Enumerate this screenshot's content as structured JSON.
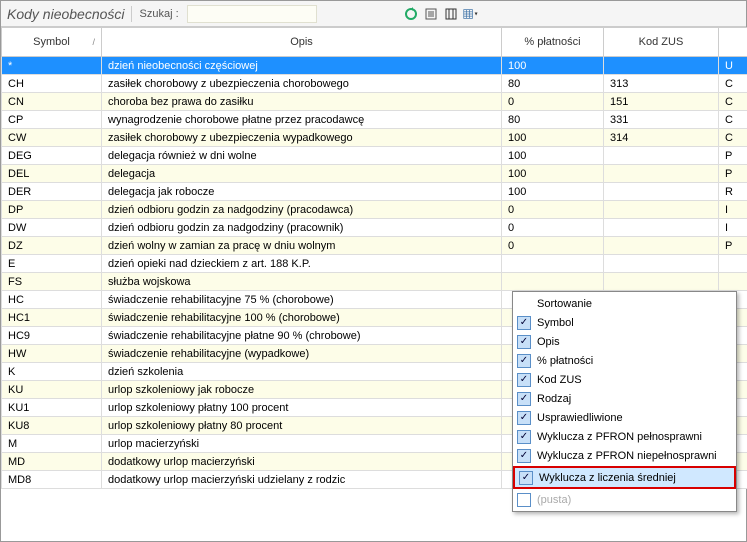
{
  "header": {
    "title": "Kody nieobecności",
    "search_label": "Szukaj :",
    "search_value": ""
  },
  "columns": {
    "symbol": "Symbol",
    "opis": "Opis",
    "platnosci": "% płatności",
    "zus": "Kod ZUS"
  },
  "rows": [
    {
      "sym": "*",
      "opis": "dzień nieobecności częściowej",
      "plat": "100",
      "zus": "",
      "ex": "U",
      "sel": true
    },
    {
      "sym": "CH",
      "opis": "zasiłek chorobowy z ubezpieczenia chorobowego",
      "plat": "80",
      "zus": "313",
      "ex": "C"
    },
    {
      "sym": "CN",
      "opis": "choroba bez prawa do zasiłku",
      "plat": "0",
      "zus": "151",
      "ex": "C"
    },
    {
      "sym": "CP",
      "opis": "wynagrodzenie chorobowe płatne przez pracodawcę",
      "plat": "80",
      "zus": "331",
      "ex": "C"
    },
    {
      "sym": "CW",
      "opis": "zasiłek chorobowy z ubezpieczenia wypadkowego",
      "plat": "100",
      "zus": "314",
      "ex": "C"
    },
    {
      "sym": "DEG",
      "opis": "delegacja również w dni wolne",
      "plat": "100",
      "zus": "",
      "ex": "P"
    },
    {
      "sym": "DEL",
      "opis": "delegacja",
      "plat": "100",
      "zus": "",
      "ex": "P"
    },
    {
      "sym": "DER",
      "opis": "delegacja jak robocze",
      "plat": "100",
      "zus": "",
      "ex": "R"
    },
    {
      "sym": "DP",
      "opis": "dzień odbioru godzin za nadgodziny (pracodawca)",
      "plat": "0",
      "zus": "",
      "ex": "I"
    },
    {
      "sym": "DW",
      "opis": "dzień odbioru godzin za nadgodziny (pracownik)",
      "plat": "0",
      "zus": "",
      "ex": "I"
    },
    {
      "sym": "DZ",
      "opis": "dzień wolny w zamian za pracę w dniu wolnym",
      "plat": "0",
      "zus": "",
      "ex": "P"
    },
    {
      "sym": "E",
      "opis": "dzień opieki nad dzieckiem z art. 188 K.P.",
      "plat": "",
      "zus": "",
      "ex": ""
    },
    {
      "sym": "FS",
      "opis": "służba wojskowa",
      "plat": "",
      "zus": "",
      "ex": ""
    },
    {
      "sym": "HC",
      "opis": "świadczenie rehabilitacyjne 75 % (chorobowe)",
      "plat": "",
      "zus": "",
      "ex": ""
    },
    {
      "sym": "HC1",
      "opis": "świadczenie rehabilitacyjne 100 % (chorobowe)",
      "plat": "",
      "zus": "",
      "ex": ""
    },
    {
      "sym": "HC9",
      "opis": "świadczenie rehabilitacyjne płatne 90 % (chrobowe)",
      "plat": "",
      "zus": "",
      "ex": ""
    },
    {
      "sym": "HW",
      "opis": "świadczenie rehabilitacyjne (wypadkowe)",
      "plat": "",
      "zus": "",
      "ex": ""
    },
    {
      "sym": "K",
      "opis": "dzień szkolenia",
      "plat": "",
      "zus": "",
      "ex": ""
    },
    {
      "sym": "KU",
      "opis": "urlop szkoleniowy jak robocze",
      "plat": "",
      "zus": "",
      "ex": ""
    },
    {
      "sym": "KU1",
      "opis": "urlop szkoleniowy płatny 100 procent",
      "plat": "",
      "zus": "",
      "ex": ""
    },
    {
      "sym": "KU8",
      "opis": "urlop szkoleniowy płatny 80 procent",
      "plat": "",
      "zus": "",
      "ex": ""
    },
    {
      "sym": "M",
      "opis": "urlop macierzyński",
      "plat": "",
      "zus": "",
      "ex": ""
    },
    {
      "sym": "MD",
      "opis": "dodatkowy urlop macierzyński",
      "plat": "",
      "zus": "",
      "ex": ""
    },
    {
      "sym": "MD8",
      "opis": "dodatkowy urlop macierzyński udzielany z rodzic",
      "plat": "",
      "zus": "",
      "ex": ""
    }
  ],
  "context_menu": {
    "items": [
      {
        "label": "Sortowanie",
        "check": false
      },
      {
        "label": "Symbol",
        "check": true
      },
      {
        "label": "Opis",
        "check": true
      },
      {
        "label": "% płatności",
        "check": true
      },
      {
        "label": "Kod ZUS",
        "check": true
      },
      {
        "label": "Rodzaj",
        "check": true
      },
      {
        "label": "Usprawiedliwione",
        "check": true
      },
      {
        "label": "Wyklucza z PFRON pełnosprawni",
        "check": true
      },
      {
        "label": "Wyklucza z PFRON niepełnosprawni",
        "check": true
      },
      {
        "label": "Wyklucza z liczenia średniej",
        "check": true,
        "highlight": true
      },
      {
        "label": "(pusta)",
        "check": true,
        "disabled": true,
        "unchecked": true
      }
    ]
  }
}
